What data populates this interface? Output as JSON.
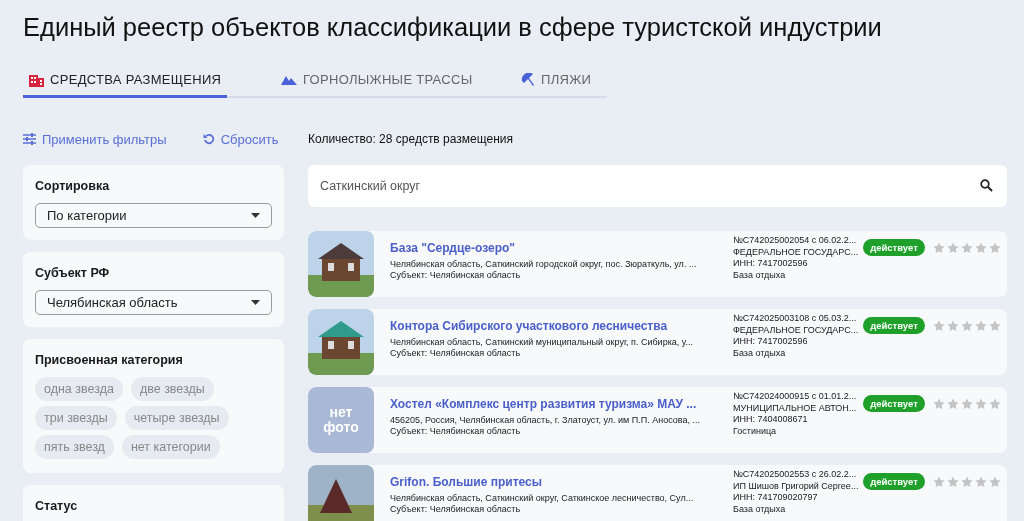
{
  "title": "Единый реестр объектов классификации в сфере туристской индустрии",
  "tabs": [
    {
      "label": "СРЕДСТВА РАЗМЕЩЕНИЯ",
      "kind": "building",
      "selected": true
    },
    {
      "label": "ГОРНОЛЫЖНЫЕ ТРАССЫ",
      "kind": "mountain",
      "selected": false
    },
    {
      "label": "ПЛЯЖИ",
      "kind": "umbrella",
      "selected": false
    }
  ],
  "toolbar": {
    "apply": "Применить фильтры",
    "reset": "Сбросить",
    "count": "Количество: 28 средств размещения"
  },
  "filters": [
    {
      "kind": "select",
      "title": "Сортировка",
      "value": "По категории"
    },
    {
      "kind": "select",
      "title": "Субъект РФ",
      "value": "Челябинская область"
    },
    {
      "kind": "chips",
      "title": "Присвоенная категория",
      "chips": [
        {
          "label": "одна звезда",
          "selected": false
        },
        {
          "label": "две звезды",
          "selected": false
        },
        {
          "label": "три звезды",
          "selected": false
        },
        {
          "label": "четыре звезды",
          "selected": false
        },
        {
          "label": "пять звезд",
          "selected": false
        },
        {
          "label": "нет категории",
          "selected": false
        }
      ]
    },
    {
      "kind": "heading",
      "title": "Статус"
    }
  ],
  "search": {
    "value": "Саткинский округ"
  },
  "results": [
    {
      "has_photo": true,
      "name": "База \"Сердце-озеро\"",
      "address": "Челябинская область, Саткинский городской округ, пос. Зюраткуль, ул. ...",
      "subject": "Субъект: Челябинская область",
      "certificate": "№С742025002054 с 06.02.2...",
      "owner": "ФЕДЕРАЛЬНОЕ ГОСУДАРС...",
      "inn": "ИНН: 7417002596",
      "type": "База отдыха",
      "status": "действует",
      "stars": 0
    },
    {
      "has_photo": true,
      "name": "Контора Сибирского участкового лесничества",
      "address": "Челябинская область, Саткинский муниципальный округ, п. Сибирка, у...",
      "subject": "Субъект: Челябинская область",
      "certificate": "№С742025003108 с 05.03.2...",
      "owner": "ФЕДЕРАЛЬНОЕ ГОСУДАРС...",
      "inn": "ИНН: 7417002596",
      "type": "База отдыха",
      "status": "действует",
      "stars": 0
    },
    {
      "has_photo": false,
      "photo_text": "нет фото",
      "name": "Хостел «Комплекс центр развития туризма» МАУ ...",
      "address": "456205, Россия, Челябинская область, г. Златоуст, ул. им П.П. Аносова, ...",
      "subject": "Субъект: Челябинская область",
      "certificate": "№С742024000915 с 01.01.2...",
      "owner": "МУНИЦИПАЛЬНОЕ АВТОН...",
      "inn": "ИНН: 7404008671",
      "type": "Гостиница",
      "status": "действует",
      "stars": 0
    },
    {
      "has_photo": true,
      "name": "Grifon. Большие притесы",
      "address": "Челябинская область, Саткинский округ, Саткинское лесничество, Сул...",
      "subject": "Субъект: Челябинская область",
      "certificate": "№С742025002553 с 26.02.2...",
      "owner": "ИП Шишов Григорий Сергее...",
      "inn": "ИНН: 741709020797",
      "type": "База отдыха",
      "status": "действует",
      "stars": 0
    }
  ]
}
